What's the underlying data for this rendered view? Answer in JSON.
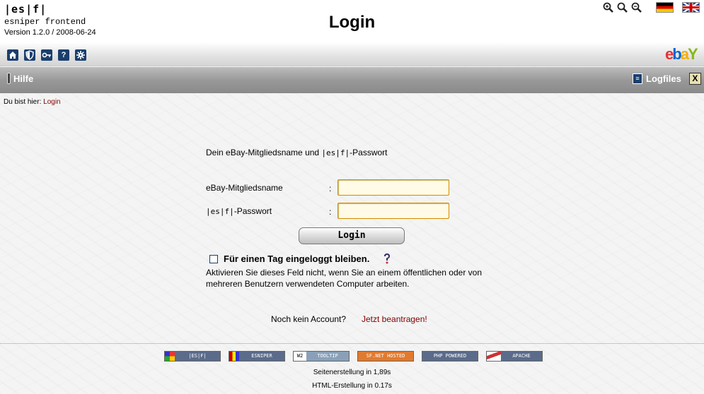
{
  "header": {
    "logo": "|es|f|",
    "subtitle": "esniper frontend",
    "version": "Version 1.2.0 / 2008-06-24",
    "page_title": "Login"
  },
  "toolbar": {
    "icons": [
      "home-icon",
      "shield-icon",
      "key-icon",
      "help-icon",
      "settings-icon"
    ]
  },
  "navbar": {
    "left_label": "Hilfe",
    "right_label": "Logfiles"
  },
  "breadcrumb": {
    "prefix": "Du bist hier:",
    "current": "Login"
  },
  "form": {
    "intro_prefix": "Dein eBay-Mitgliedsname und ",
    "intro_logo": "|es|f|",
    "intro_suffix": "-Passwort",
    "username_label": "eBay-Mitgliedsname",
    "password_label_logo": "|es|f|",
    "password_label_suffix": "-Passwort",
    "colon": ":",
    "username_value": "",
    "password_value": "",
    "login_button": "Login",
    "stay_logged_in_label": "Für einen Tag eingeloggt bleiben.",
    "stay_logged_in_checked": false,
    "help_text": "Aktivieren Sie dieses Feld nicht, wenn Sie an einem öffentlichen oder von mehreren Benutzern verwendeten Computer arbeiten.",
    "no_account_text": "Noch kein Account?",
    "register_link": "Jetzt beantragen!"
  },
  "footer": {
    "badges": [
      {
        "label": "|ES|F|",
        "color": "#5b6b8a"
      },
      {
        "label": "ESNIPER",
        "color": "#5b6b8a"
      },
      {
        "label": "TOOLTIP",
        "color": "#8aa0b8"
      },
      {
        "label": "SF.NET HOSTED",
        "color": "#e07a30"
      },
      {
        "label": "PHP POWERED",
        "color": "#5b6b8a"
      },
      {
        "label": "APACHE",
        "color": "#5b6b8a"
      }
    ],
    "page_time": "Seitenerstellung in 1,89s",
    "html_time": "HTML-Erstellung in 0.17s"
  }
}
